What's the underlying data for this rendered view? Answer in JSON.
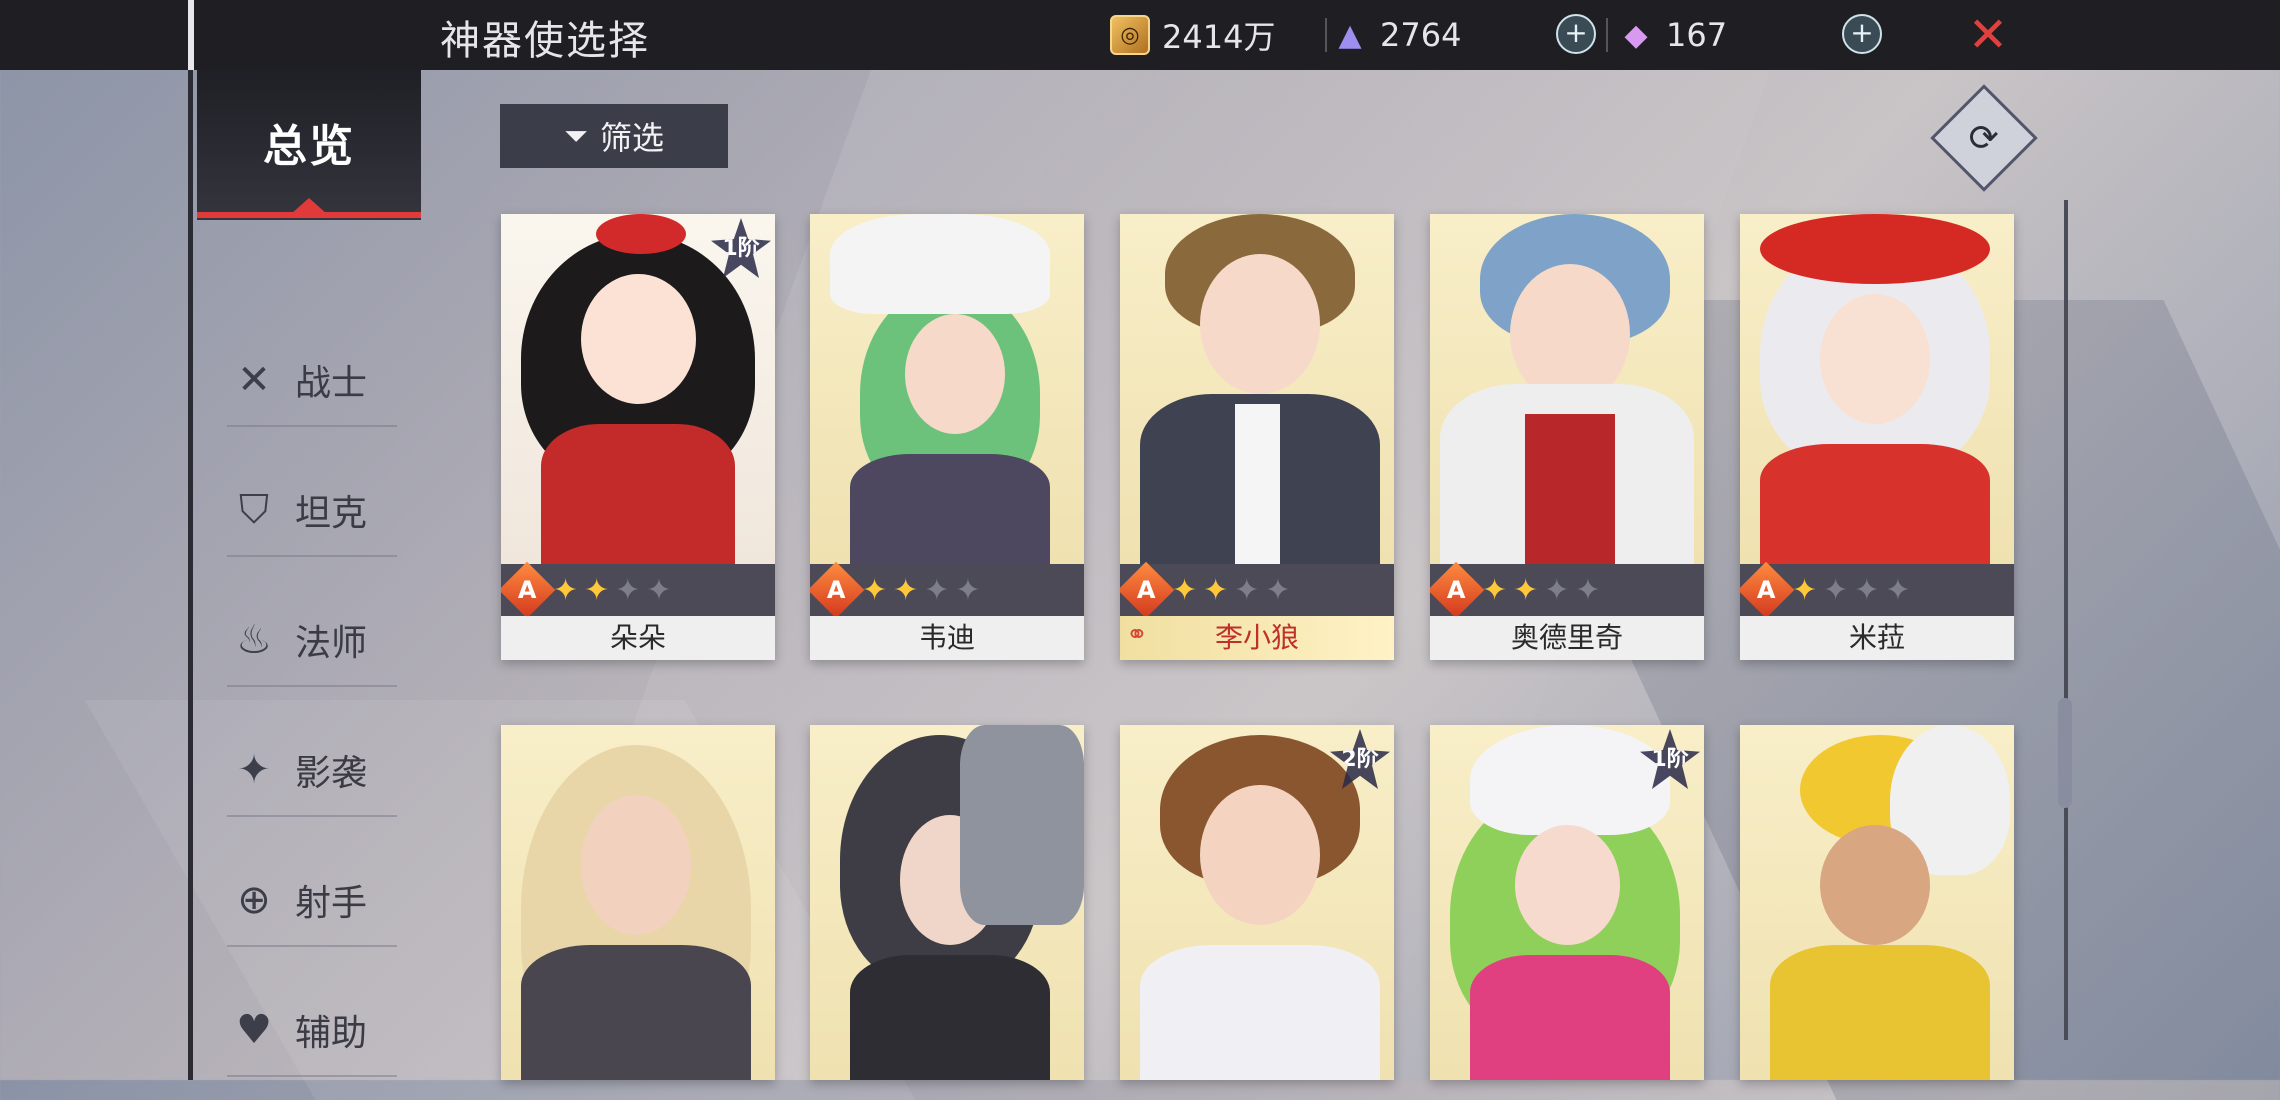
{
  "title": "神器使选择",
  "resources": {
    "gold": "2414万",
    "crystal": "2764",
    "gem": "167"
  },
  "icons": {
    "gold": "coin-icon",
    "crystal": "triangle-crystal-icon",
    "gem": "diamond-icon",
    "close": "close-icon",
    "filter": "funnel-icon",
    "sort": "refresh-icon"
  },
  "sidebar": {
    "overview": "总览",
    "items": [
      {
        "label": "战士",
        "icon": "crossed-swords-icon"
      },
      {
        "label": "坦克",
        "icon": "helmet-icon"
      },
      {
        "label": "法师",
        "icon": "flame-icon"
      },
      {
        "label": "影袭",
        "icon": "shuriken-icon"
      },
      {
        "label": "射手",
        "icon": "crosshair-icon"
      },
      {
        "label": "辅助",
        "icon": "heart-icon"
      }
    ]
  },
  "filter_label": "筛选",
  "cards": [
    {
      "name": "朵朵",
      "rank": "A",
      "stars": 2,
      "max_stars": 5,
      "tier": "1阶"
    },
    {
      "name": "韦迪",
      "rank": "A",
      "stars": 2,
      "max_stars": 5
    },
    {
      "name": "李小狼",
      "rank": "A",
      "stars": 2,
      "max_stars": 5,
      "selected": true
    },
    {
      "name": "奥德里奇",
      "rank": "A",
      "stars": 2,
      "max_stars": 5
    },
    {
      "name": "米菈",
      "rank": "A",
      "stars": 1,
      "max_stars": 5
    },
    {
      "name": "",
      "tier": ""
    },
    {
      "name": "",
      "tier": ""
    },
    {
      "name": "",
      "tier": "2阶"
    },
    {
      "name": "",
      "tier": "1阶"
    },
    {
      "name": "",
      "tier": ""
    }
  ],
  "colors": {
    "accent_red": "#e03a3a",
    "topbar": "#1f1f23",
    "star_on": "#ffc83a"
  }
}
